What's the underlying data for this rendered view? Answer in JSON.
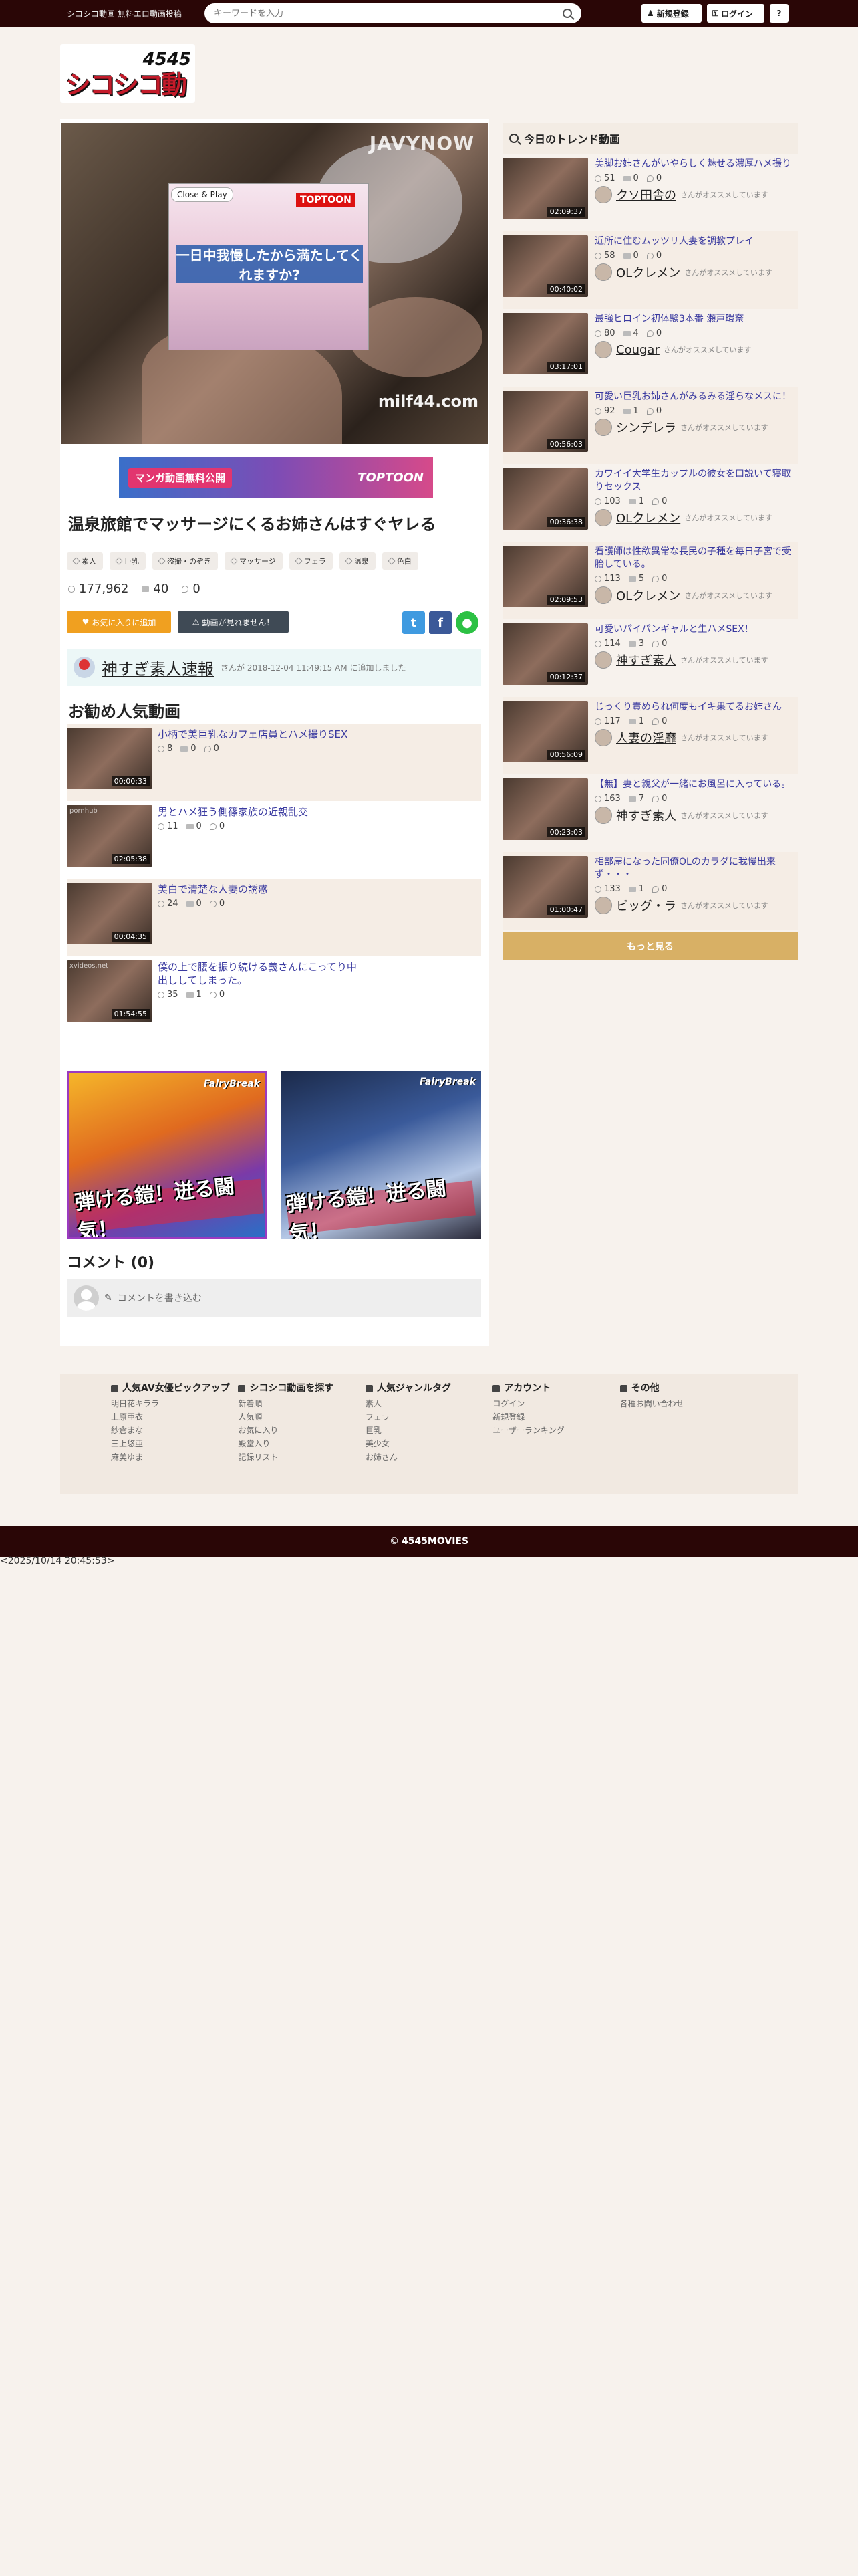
{
  "header": {
    "site_tag": "シコシコ動画 無料エロ動画投稿",
    "search_placeholder": "キーワードを入力",
    "register_label": "新規登録",
    "login_label": "ログイン",
    "help_label": "?"
  },
  "logo": {
    "number": "4545",
    "word": "シコシコ動画"
  },
  "player": {
    "brand_top": "JAVYNOW",
    "brand_bottom": "milf44.com",
    "close_play": "Close & Play",
    "ad_text": "一日中我慢したから満たしてくれますか?",
    "ad_logo": "TOPTOON"
  },
  "ad_banner": {
    "text": "マンガ動画無料公開",
    "logo": "TOPTOON"
  },
  "video": {
    "title": "温泉旅館でマッサージにくるお姉さんはすぐヤレる",
    "tags": [
      "素人",
      "巨乳",
      "盗撮・のぞき",
      "マッサージ",
      "フェラ",
      "温泉",
      "色白"
    ],
    "views": "177,962",
    "favorites": "40",
    "comments": "0",
    "fav_button": "お気に入りに追加",
    "report_button": "動画が見れません！"
  },
  "uploader": {
    "name": "神すぎ素人速報",
    "meta": "さんが 2018-12-04 11:49:15 AM に追加しました"
  },
  "recommended": {
    "title": "お勧め人気動画",
    "items": [
      {
        "title": "小柄で美巨乳なカフェ店員とハメ撮りSEX",
        "duration": "00:00:33",
        "views": "8",
        "favs": "0",
        "comments": "0",
        "site": ""
      },
      {
        "title": "男とハメ狂う側篠家族の近親乱交",
        "duration": "02:05:38",
        "views": "11",
        "favs": "0",
        "comments": "0",
        "site": "pornhub"
      },
      {
        "title": "美白で清楚な人妻の誘惑",
        "duration": "00:04:35",
        "views": "24",
        "favs": "0",
        "comments": "0",
        "site": ""
      },
      {
        "title": "僕の上で腰を振り続ける義さんにこってり中出ししてしまった。",
        "duration": "01:54:55",
        "views": "35",
        "favs": "1",
        "comments": "0",
        "site": "xvideos.net"
      }
    ]
  },
  "promos": {
    "left_text": "弾ける鎧！迸る闘気！",
    "left_brand": "FairyBreak",
    "right_text": "弾ける鎧！迸る闘気！",
    "right_brand": "FairyBreak"
  },
  "comments": {
    "title": "コメント (0)",
    "placeholder": "コメントを書き込む"
  },
  "trending": {
    "title": "今日のトレンド動画",
    "rec_note": "さんがオススメしています",
    "items": [
      {
        "title": "美脚お姉さんがいやらしく魅せる濃厚ハメ撮り",
        "duration": "02:09:37",
        "views": "51",
        "favs": "0",
        "comments": "0",
        "user": "クソ田舎の"
      },
      {
        "title": "近所に住むムッツリ人妻を調教プレイ",
        "duration": "00:40:02",
        "views": "58",
        "favs": "0",
        "comments": "0",
        "user": "OLクレメン"
      },
      {
        "title": "最強ヒロイン初体験3本番 瀬戸環奈",
        "duration": "03:17:01",
        "views": "80",
        "favs": "4",
        "comments": "0",
        "user": "Cougar"
      },
      {
        "title": "可愛い巨乳お姉さんがみるみる淫らなメスに！",
        "duration": "00:56:03",
        "views": "92",
        "favs": "1",
        "comments": "0",
        "user": "シンデレラ"
      },
      {
        "title": "カワイイ大学生カップルの彼女を口説いて寝取りセックス",
        "duration": "00:36:38",
        "views": "103",
        "favs": "1",
        "comments": "0",
        "user": "OLクレメン"
      },
      {
        "title": "看護師は性欲異常な長民の子種を毎日子宮で受胎している。",
        "duration": "02:09:53",
        "views": "113",
        "favs": "5",
        "comments": "0",
        "user": "OLクレメン"
      },
      {
        "title": "可愛いパイパンギャルと生ハメSEX！",
        "duration": "00:12:37",
        "views": "114",
        "favs": "3",
        "comments": "0",
        "user": "神すぎ素人"
      },
      {
        "title": "じっくり責められ何度もイキ果てるお姉さん",
        "duration": "00:56:09",
        "views": "117",
        "favs": "1",
        "comments": "0",
        "user": "人妻の淫靡"
      },
      {
        "title": "【無】妻と親父が一緒にお風呂に入っている。",
        "duration": "00:23:03",
        "views": "163",
        "favs": "7",
        "comments": "0",
        "user": "神すぎ素人"
      },
      {
        "title": "相部屋になった同僚OLのカラダに我慢出来ず・・・",
        "duration": "01:00:47",
        "views": "133",
        "favs": "1",
        "comments": "0",
        "user": "ビッグ・ラ"
      }
    ],
    "more_label": "もっと見る"
  },
  "footer": {
    "columns": [
      {
        "title": "人気AV女優ピックアップ",
        "links": [
          "明日花キララ",
          "上原亜衣",
          "紗倉まな",
          "三上悠亜",
          "麻美ゆま"
        ]
      },
      {
        "title": "シコシコ動画を探す",
        "links": [
          "新着順",
          "人気順",
          "お気に入り",
          "殿堂入り",
          "記録リスト"
        ]
      },
      {
        "title": "人気ジャンルタグ",
        "links": [
          "素人",
          "フェラ",
          "巨乳",
          "美少女",
          "お姉さん"
        ]
      },
      {
        "title": "アカウント",
        "links": [
          "ログイン",
          "新規登録",
          "ユーザーランキング"
        ]
      },
      {
        "title": "その他",
        "links": [
          "各種お問い合わせ"
        ]
      }
    ],
    "copyright_symbol": "©",
    "copyright_name": "4545MOVIES",
    "timestamp": "<2025/10/14 20:45:53>"
  }
}
